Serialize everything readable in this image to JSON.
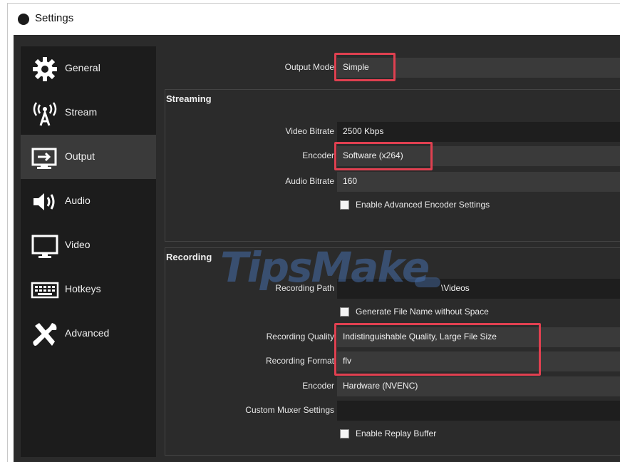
{
  "window": {
    "title": "Settings"
  },
  "sidebar": {
    "items": [
      {
        "label": "General",
        "icon": "gear-icon"
      },
      {
        "label": "Stream",
        "icon": "broadcast-antenna-icon"
      },
      {
        "label": "Output",
        "icon": "output-monitor-icon",
        "active": true
      },
      {
        "label": "Audio",
        "icon": "speaker-icon"
      },
      {
        "label": "Video",
        "icon": "monitor-icon"
      },
      {
        "label": "Hotkeys",
        "icon": "keyboard-icon"
      },
      {
        "label": "Advanced",
        "icon": "wrench-screwdriver-icon"
      }
    ]
  },
  "output_mode": {
    "label": "Output Mode",
    "value": "Simple"
  },
  "streaming": {
    "title": "Streaming",
    "video_bitrate": {
      "label": "Video Bitrate",
      "value": "2500 Kbps"
    },
    "encoder": {
      "label": "Encoder",
      "value": "Software (x264)"
    },
    "audio_bitrate": {
      "label": "Audio Bitrate",
      "value": "160"
    },
    "advanced_encoder": {
      "label": "Enable Advanced Encoder Settings"
    }
  },
  "recording": {
    "title": "Recording",
    "path": {
      "label": "Recording Path",
      "value": "\\Videos"
    },
    "gen_filename": {
      "label": "Generate File Name without Space"
    },
    "quality": {
      "label": "Recording Quality",
      "value": "Indistinguishable Quality, Large File Size"
    },
    "format": {
      "label": "Recording Format",
      "value": "flv"
    },
    "encoder": {
      "label": "Encoder",
      "value": "Hardware (NVENC)"
    },
    "muxer": {
      "label": "Custom Muxer Settings",
      "value": ""
    },
    "replay_buffer": {
      "label": "Enable Replay Buffer"
    }
  },
  "watermark": {
    "text": "TipsMake"
  },
  "colors": {
    "highlight": "#e04050",
    "panel": "#2b2b2b",
    "sidebar": "#1c1c1c"
  }
}
